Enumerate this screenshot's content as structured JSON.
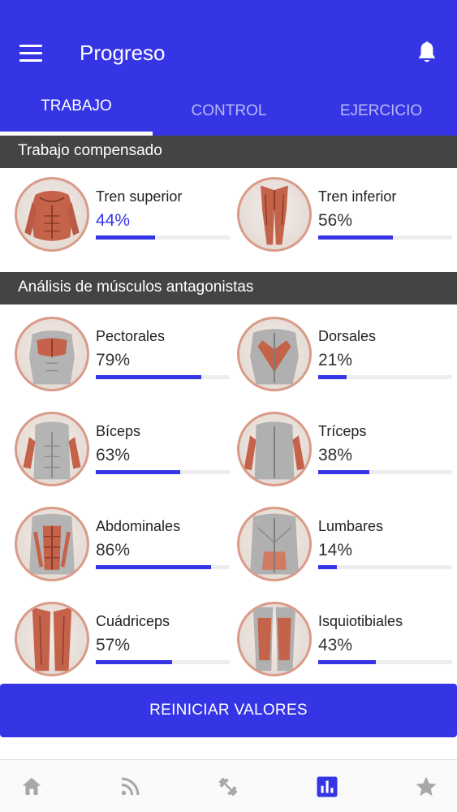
{
  "header": {
    "title": "Progreso"
  },
  "tabs": [
    "TRABAJO",
    "CONTROL",
    "EJERCICIO"
  ],
  "sections": {
    "compensated": "Trabajo compensado",
    "antagonists": "Análisis de músculos antagonistas"
  },
  "compensated": [
    {
      "label": "Tren superior",
      "value": "44%",
      "progress": 0.44
    },
    {
      "label": "Tren inferior",
      "value": "56%",
      "progress": 0.56
    }
  ],
  "muscles": [
    {
      "label": "Pectorales",
      "value": "79%",
      "progress": 0.79
    },
    {
      "label": "Dorsales",
      "value": "21%",
      "progress": 0.21
    },
    {
      "label": "Bíceps",
      "value": "63%",
      "progress": 0.63
    },
    {
      "label": "Tríceps",
      "value": "38%",
      "progress": 0.38
    },
    {
      "label": "Abdominales",
      "value": "86%",
      "progress": 0.86
    },
    {
      "label": "Lumbares",
      "value": "14%",
      "progress": 0.14
    },
    {
      "label": "Cuádriceps",
      "value": "57%",
      "progress": 0.57
    },
    {
      "label": "Isquiotibiales",
      "value": "43%",
      "progress": 0.43
    }
  ],
  "actions": {
    "reset": "REINICIAR VALORES"
  },
  "bottom_nav": [
    "home-icon",
    "feed-icon",
    "exercise-icon",
    "stats-icon",
    "favorites-icon"
  ],
  "colors": {
    "primary": "#3535e6",
    "section_bg": "#444444",
    "ring": "#d99b88",
    "nav_inactive": "#a8a8a8"
  }
}
